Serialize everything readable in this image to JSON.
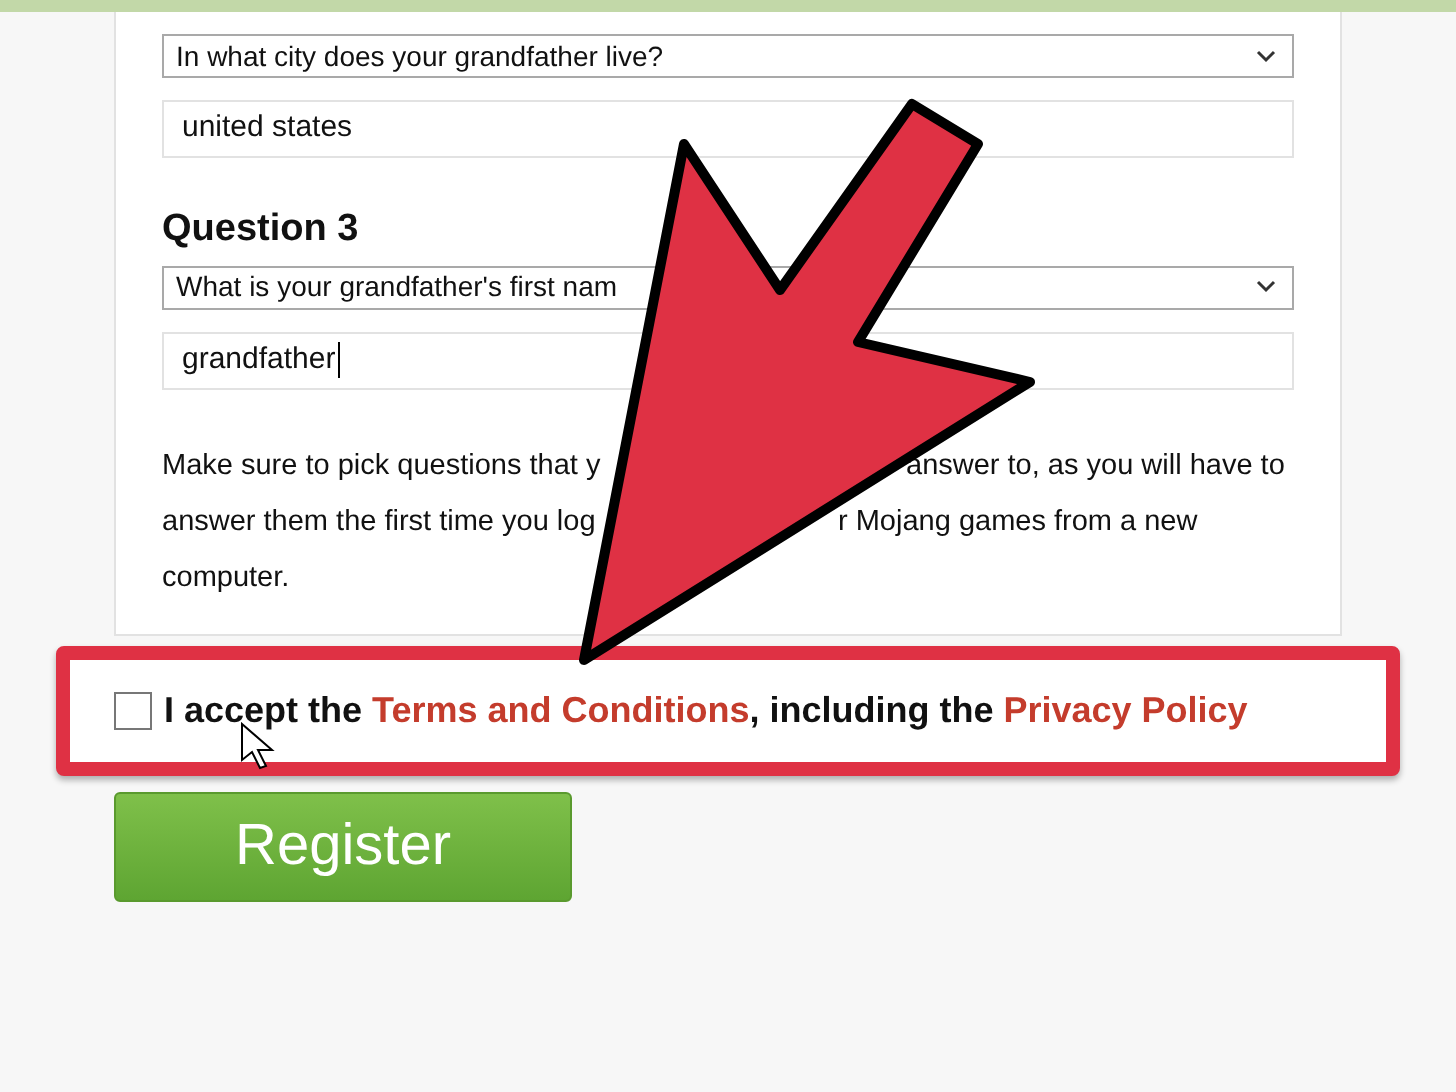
{
  "question_2": {
    "select": "In what city does your grandfather live?",
    "answer": "united states"
  },
  "question_3": {
    "heading": "Question 3",
    "select": "What is your grandfather's first nam",
    "answer": "grandfather"
  },
  "note_lines": [
    [
      "Make sure to pick questions that y",
      "answer to, as you will have to"
    ],
    [
      "answer them the first time you log",
      "r Mojang games from a new"
    ],
    [
      "computer."
    ]
  ],
  "terms": {
    "checked": false,
    "parts": [
      {
        "kind": "text",
        "text": "I accept the"
      },
      {
        "kind": "link",
        "text": "Terms and Conditions"
      },
      {
        "kind": "text",
        "text": ", including the"
      },
      {
        "kind": "link",
        "text": "Privacy Policy"
      }
    ]
  },
  "register_button": "Register"
}
